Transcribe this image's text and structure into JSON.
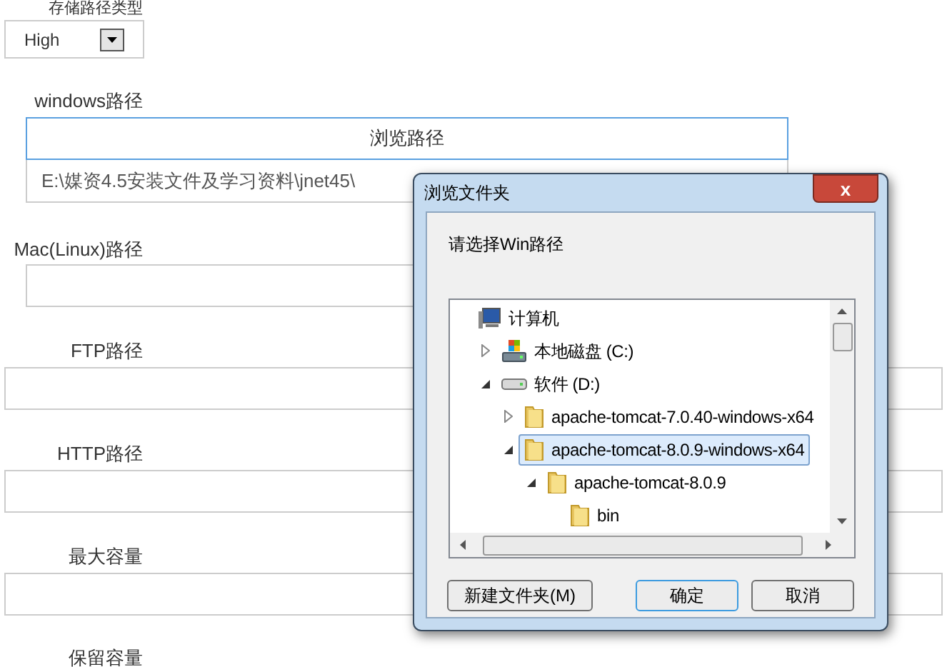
{
  "form": [
    {
      "kind": "select",
      "label": "存储路径类型",
      "value": "High"
    },
    {
      "kind": "browse",
      "label": "windows路径",
      "button": "浏览路径",
      "value": "E:\\媒资4.5安装文件及学习资料\\jnet45\\"
    },
    {
      "kind": "path",
      "label": "Mac(Linux)路径"
    },
    {
      "kind": "text",
      "label": "FTP路径"
    },
    {
      "kind": "text",
      "label": "HTTP路径"
    },
    {
      "kind": "text",
      "label": "最大容量"
    },
    {
      "kind": "label",
      "label": "保留容量"
    }
  ],
  "dialog": {
    "title": "浏览文件夹",
    "close": "x",
    "prompt": "请选择Win路径",
    "tree": [
      {
        "label": "计算机",
        "kind": "computer",
        "selected": false,
        "children": [
          {
            "label": "本地磁盘 (C:)",
            "kind": "system-drive",
            "expanded": false,
            "selected": false
          },
          {
            "label": "软件 (D:)",
            "kind": "drive",
            "expanded": true,
            "selected": false,
            "children": [
              {
                "label": "apache-tomcat-7.0.40-windows-x64",
                "kind": "folder",
                "expanded": false,
                "selected": false
              },
              {
                "label": "apache-tomcat-8.0.9-windows-x64",
                "kind": "folder",
                "expanded": true,
                "selected": true,
                "children": [
                  {
                    "label": "apache-tomcat-8.0.9",
                    "kind": "folder",
                    "expanded": true,
                    "selected": false,
                    "children": [
                      {
                        "label": "bin",
                        "kind": "folder",
                        "selected": false
                      }
                    ]
                  }
                ]
              }
            ]
          }
        ]
      }
    ],
    "buttons": [
      {
        "label": "新建文件夹(M)",
        "default": false
      },
      {
        "label": "确定",
        "default": true
      },
      {
        "label": "取消",
        "default": false
      }
    ]
  }
}
